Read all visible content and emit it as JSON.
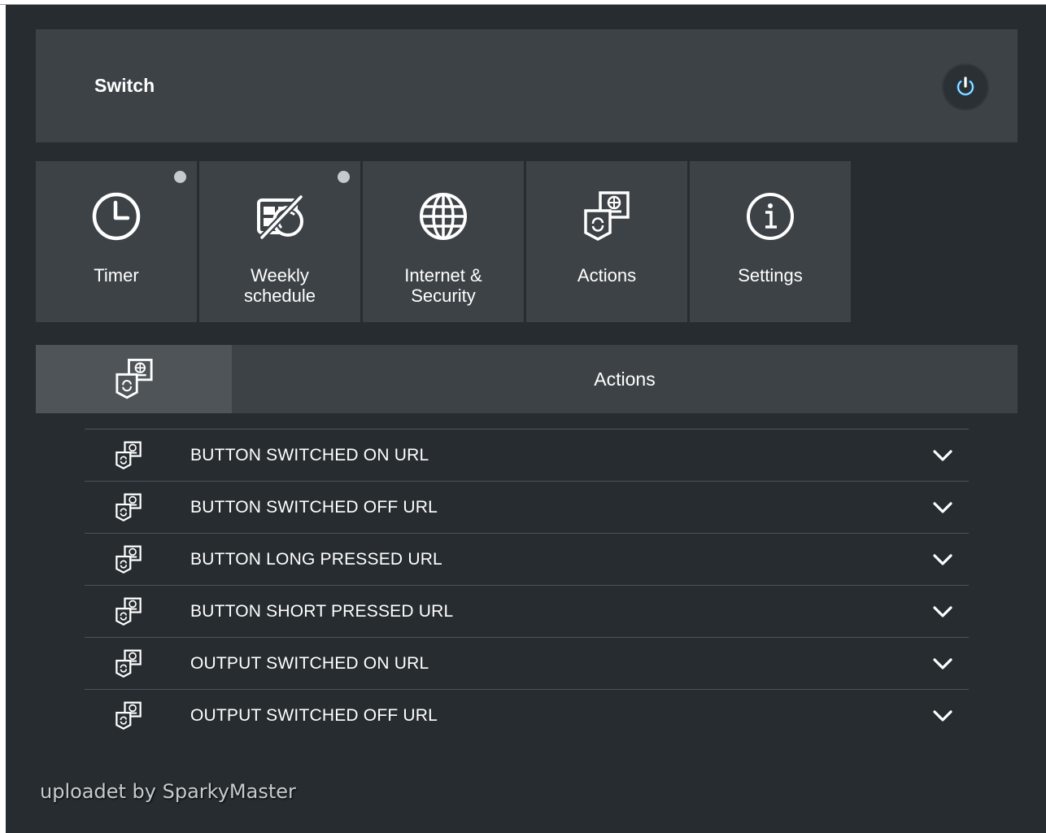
{
  "header": {
    "title": "Switch",
    "power_icon": "power-icon",
    "power_color": "#1e9be6"
  },
  "tiles": [
    {
      "label": "Timer",
      "icon": "clock-icon",
      "indicator": true
    },
    {
      "label": "Weekly\nschedule",
      "icon": "calendar-off-icon",
      "indicator": true
    },
    {
      "label": "Internet &\nSecurity",
      "icon": "globe-icon",
      "indicator": false
    },
    {
      "label": "Actions",
      "icon": "actions-icon",
      "indicator": false
    },
    {
      "label": "Settings",
      "icon": "info-icon",
      "indicator": false
    }
  ],
  "section": {
    "title": "Actions",
    "icon": "actions-icon"
  },
  "actions": [
    {
      "label": "BUTTON SWITCHED ON URL",
      "icon": "actions-icon"
    },
    {
      "label": "BUTTON SWITCHED OFF URL",
      "icon": "actions-icon"
    },
    {
      "label": "BUTTON LONG PRESSED URL",
      "icon": "actions-icon"
    },
    {
      "label": "BUTTON SHORT PRESSED URL",
      "icon": "actions-icon"
    },
    {
      "label": "OUTPUT SWITCHED ON URL",
      "icon": "actions-icon"
    },
    {
      "label": "OUTPUT SWITCHED OFF URL",
      "icon": "actions-icon"
    }
  ],
  "footer": {
    "credit": "uploadet by SparkyMaster"
  },
  "colors": {
    "background": "#262c30",
    "panel": "#3c4246",
    "panel_active": "#4e5458",
    "text": "#ffffff",
    "indicator": "#c7cacc"
  }
}
